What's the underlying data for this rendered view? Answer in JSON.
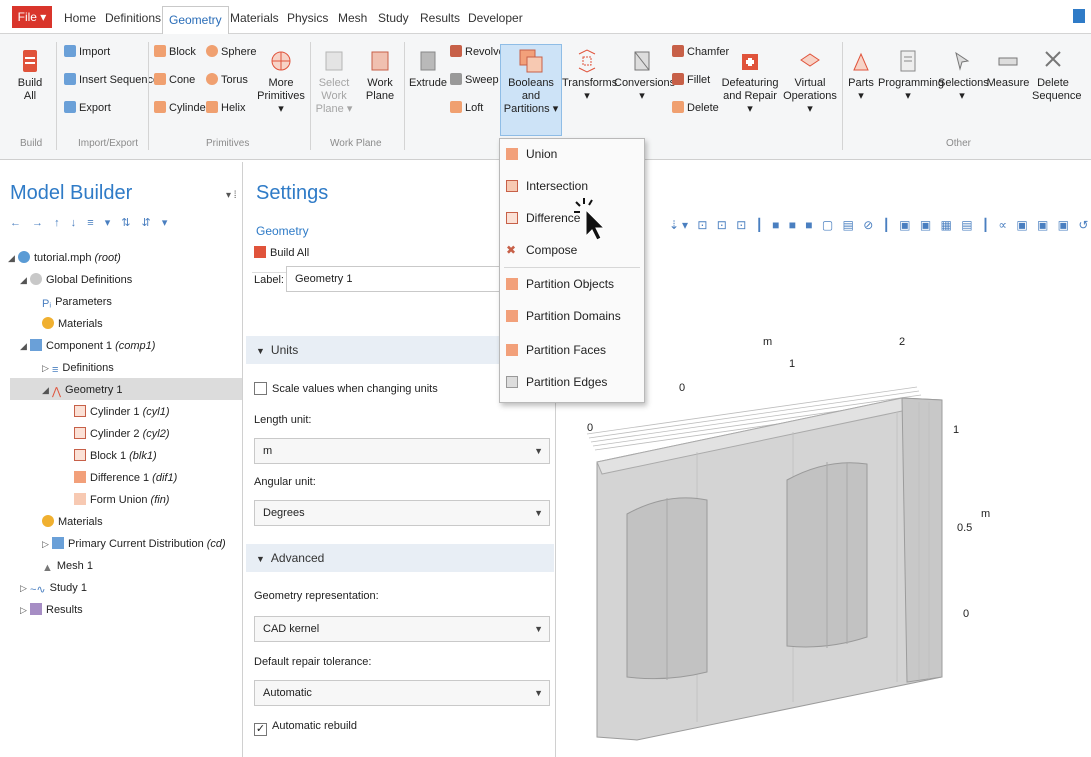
{
  "tabs": {
    "file": "File ▾",
    "items": [
      "Home",
      "Definitions",
      "Geometry",
      "Materials",
      "Physics",
      "Mesh",
      "Study",
      "Results",
      "Developer"
    ],
    "active": "Geometry"
  },
  "ribbon": {
    "build_all": "Build All",
    "build_group": "Build",
    "import": "Import",
    "insert_sequence": "Insert Sequence",
    "export": "Export",
    "import_export_group": "Import/Export",
    "block": "Block",
    "cone": "Cone",
    "cylinder": "Cylinder",
    "sphere": "Sphere",
    "torus": "Torus",
    "helix": "Helix",
    "more_primitives": "More Primitives ▾",
    "primitives_group": "Primitives",
    "select_work_plane": "Select Work Plane ▾",
    "work_plane": "Work Plane",
    "work_plane_group": "Work Plane",
    "extrude": "Extrude",
    "revolve": "Revolve",
    "sweep": "Sweep",
    "loft": "Loft",
    "booleans": "Booleans and Partitions ▾",
    "transforms": "Transforms ▾",
    "conversions": "Conversions ▾",
    "chamfer": "Chamfer",
    "fillet": "Fillet",
    "delete": "Delete",
    "defeaturing": "Defeaturing and Repair ▾",
    "virtual_operations": "Virtual Operations ▾",
    "parts": "Parts ▾",
    "programming": "Programming ▾",
    "selections": "Selections ▾",
    "measure": "Measure",
    "delete_sequence": "Delete Sequence",
    "other_group": "Other"
  },
  "menu": {
    "items": [
      "Union",
      "Intersection",
      "Difference",
      "Compose",
      "Partition Objects",
      "Partition Domains",
      "Partition Faces",
      "Partition Edges"
    ]
  },
  "model_builder": {
    "title": "Model Builder",
    "tree": {
      "root": "tutorial.mph",
      "root_tag": "(root)",
      "global_definitions": "Global Definitions",
      "parameters": "Parameters",
      "materials_global": "Materials",
      "component": "Component 1",
      "component_tag": "(comp1)",
      "definitions": "Definitions",
      "geometry": "Geometry 1",
      "cyl1": "Cylinder 1",
      "cyl1_tag": "(cyl1)",
      "cyl2": "Cylinder 2",
      "cyl2_tag": "(cyl2)",
      "blk1": "Block 1",
      "blk1_tag": "(blk1)",
      "dif1": "Difference 1",
      "dif1_tag": "(dif1)",
      "fin": "Form Union",
      "fin_tag": "(fin)",
      "materials": "Materials",
      "pcd": "Primary Current Distribution",
      "pcd_tag": "(cd)",
      "mesh": "Mesh 1",
      "study": "Study 1",
      "results": "Results"
    }
  },
  "settings": {
    "title": "Settings",
    "subtitle": "Geometry",
    "build_all": "Build All",
    "label_caption": "Label:",
    "label_value": "Geometry 1",
    "units_section": "Units",
    "scale_values": "Scale values when changing units",
    "length_unit_caption": "Length unit:",
    "length_unit": "m",
    "angular_unit_caption": "Angular unit:",
    "angular_unit": "Degrees",
    "advanced_section": "Advanced",
    "geom_rep_caption": "Geometry representation:",
    "geom_rep": "CAD kernel",
    "repair_tol_caption": "Default repair tolerance:",
    "repair_tol": "Automatic",
    "auto_rebuild": "Automatic rebuild"
  },
  "graphics": {
    "axis_labels": {
      "m_top": "m",
      "x0": "0",
      "x1": "1",
      "x2": "2",
      "left0": "0",
      "right1": "1",
      "right05": "0.5",
      "right0": "0",
      "m_right": "m"
    }
  },
  "colors": {
    "accent_blue": "#2f7bc7",
    "file_red": "#d9352b",
    "highlight": "#cde3f7"
  }
}
